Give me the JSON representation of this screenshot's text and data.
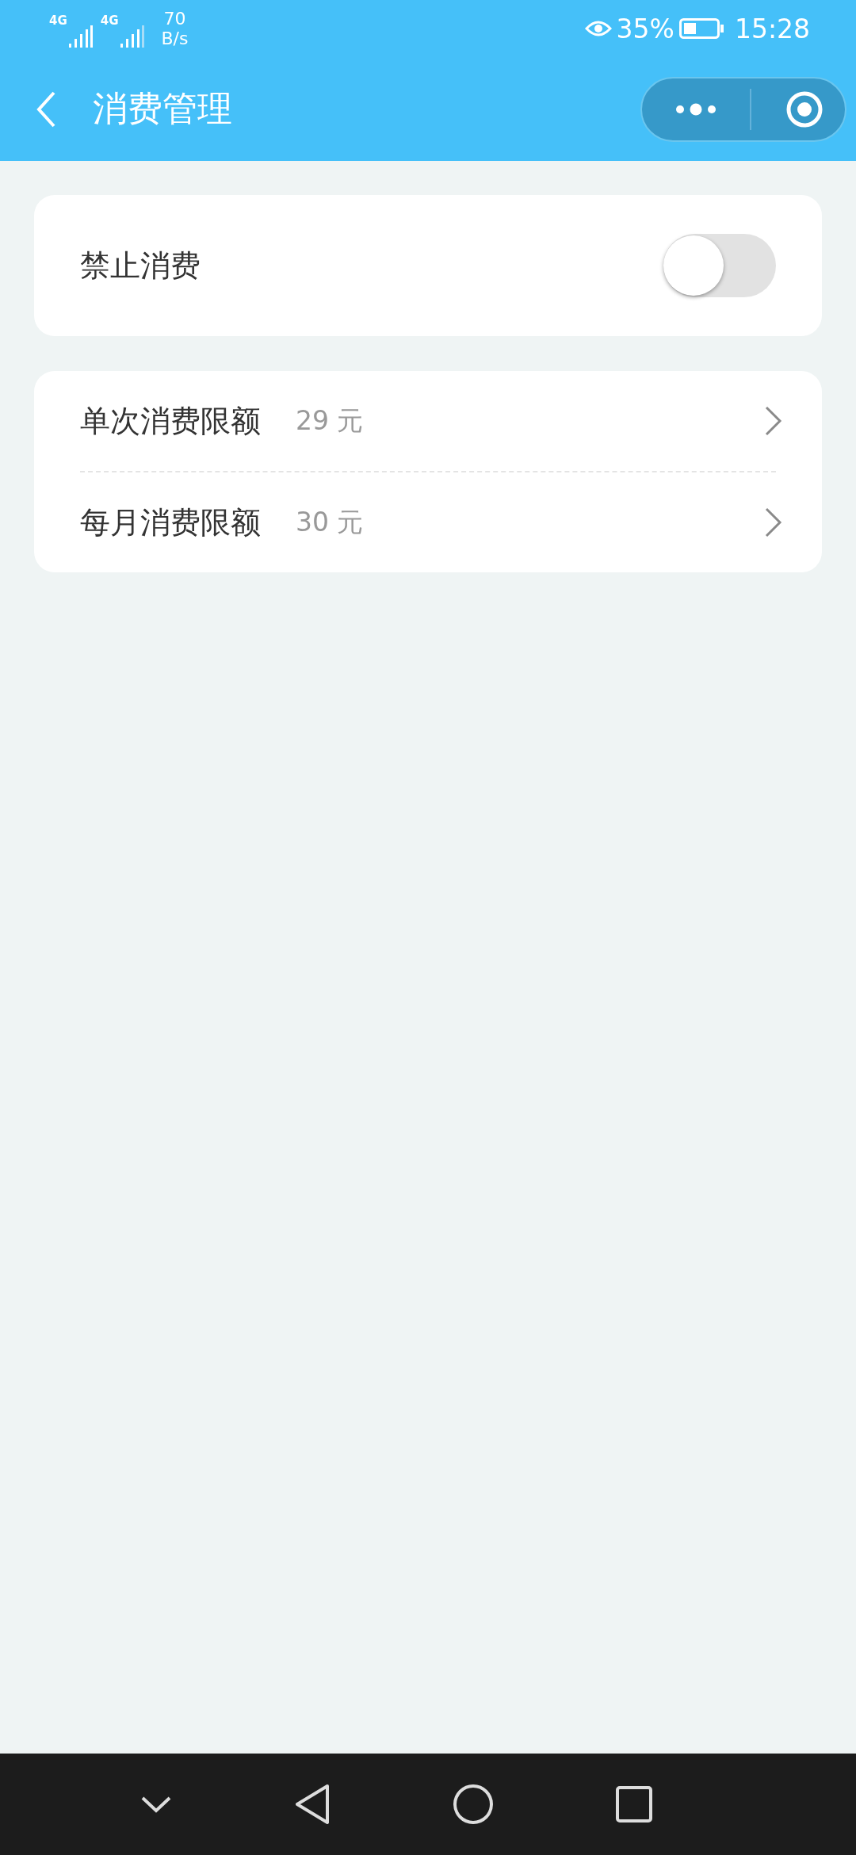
{
  "status_bar": {
    "network_labels": [
      "4G",
      "4G"
    ],
    "speed_value": "70",
    "speed_unit": "B/s",
    "battery": "35%",
    "time": "15:28"
  },
  "header": {
    "title": "消费管理"
  },
  "toggle_card": {
    "label": "禁止消费",
    "on": false
  },
  "limits": [
    {
      "label": "单次消费限额",
      "value": "29 元"
    },
    {
      "label": "每月消费限额",
      "value": "30 元"
    }
  ]
}
